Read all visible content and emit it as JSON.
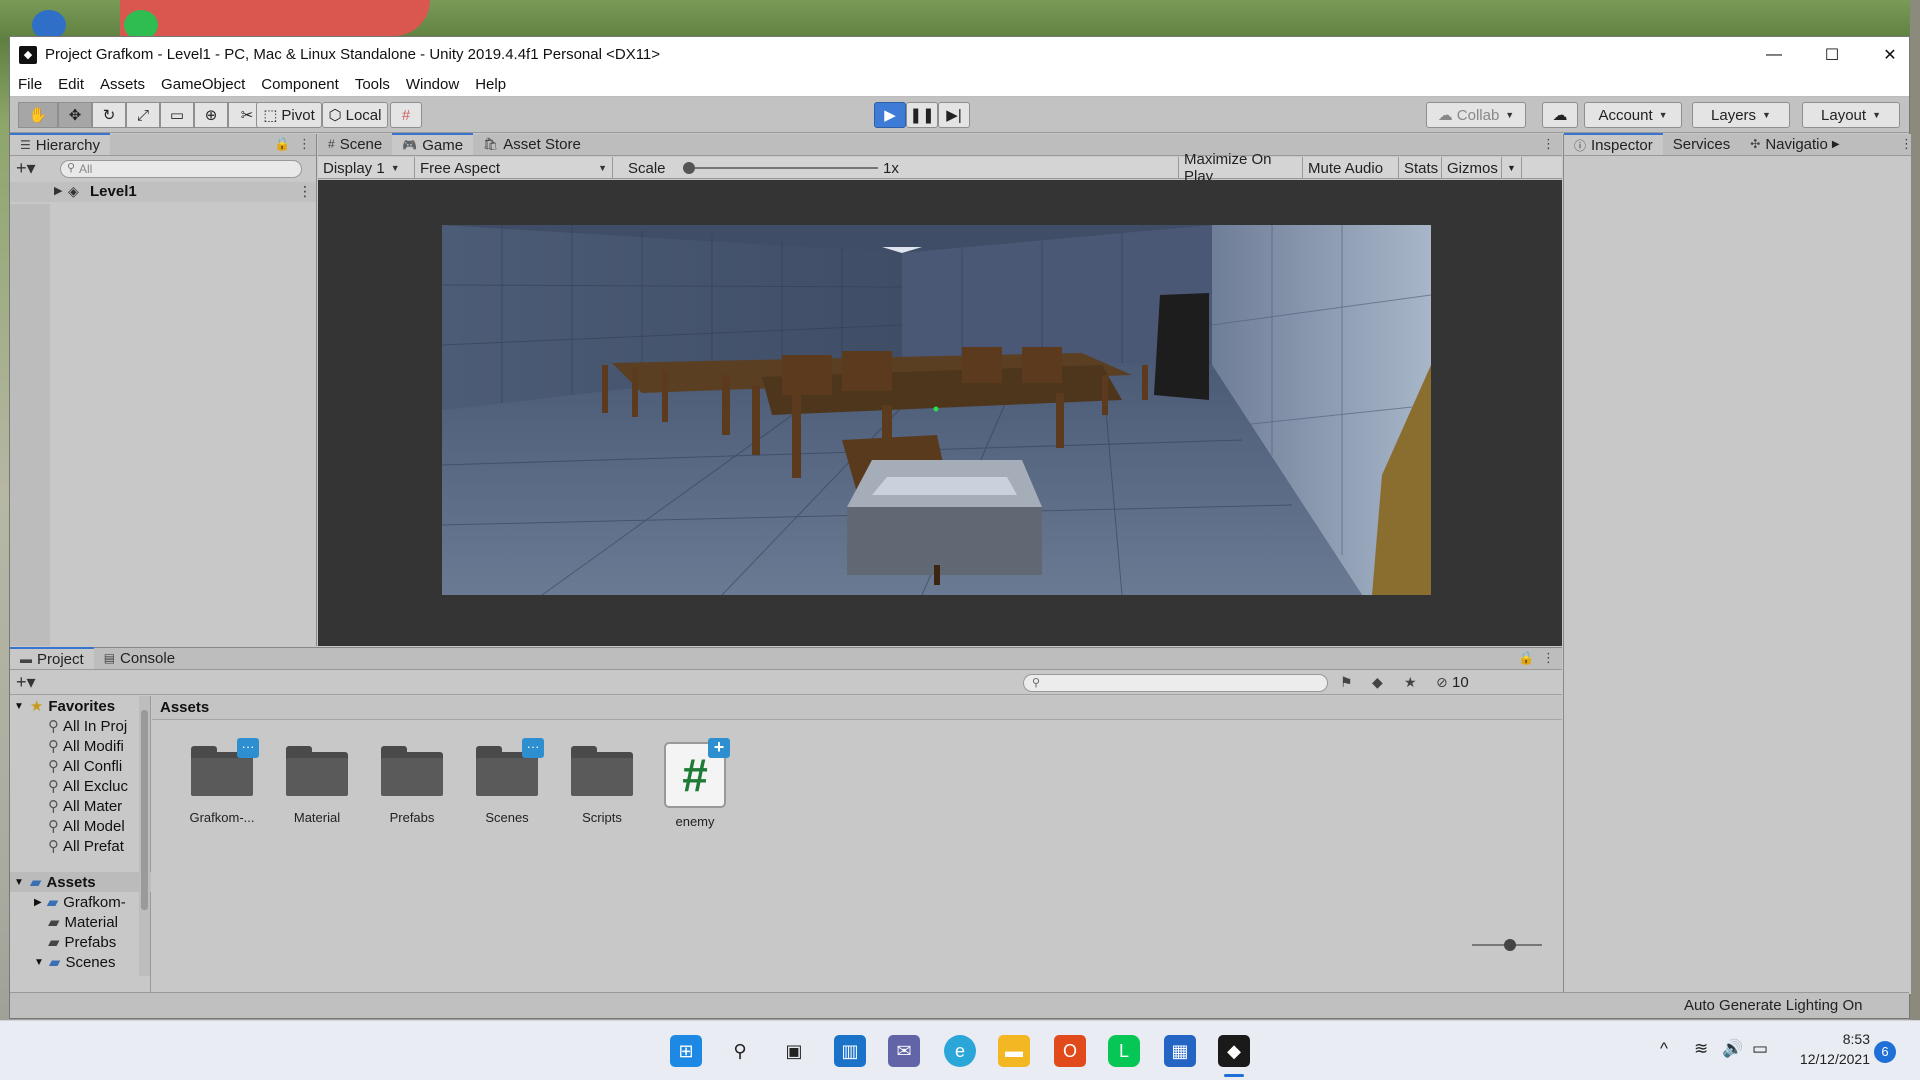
{
  "window": {
    "title": "Project Grafkom - Level1 - PC, Mac & Linux Standalone - Unity 2019.4.4f1 Personal <DX11>",
    "minimize": "—",
    "maximize": "☐",
    "close": "✕"
  },
  "menu": [
    "File",
    "Edit",
    "Assets",
    "GameObject",
    "Component",
    "Tools",
    "Window",
    "Help"
  ],
  "toolbar": {
    "pivot": "Pivot",
    "local": "Local",
    "collab": "Collab",
    "account": "Account",
    "layers": "Layers",
    "layout": "Layout"
  },
  "hierarchy": {
    "tab": "Hierarchy",
    "search_placeholder": "All",
    "scene_item": "Level1"
  },
  "center_tabs": {
    "scene": "Scene",
    "game": "Game",
    "asset_store": "Asset Store"
  },
  "game_toolbar": {
    "display": "Display 1",
    "aspect": "Free Aspect",
    "scale_label": "Scale",
    "scale_value": "1x",
    "maximize_on_play": "Maximize On Play",
    "mute_audio": "Mute Audio",
    "stats": "Stats",
    "gizmos": "Gizmos"
  },
  "right_tabs": {
    "inspector": "Inspector",
    "services": "Services",
    "navigation": "Navigatio"
  },
  "project": {
    "tab_project": "Project",
    "tab_console": "Console",
    "hidden_count": "10",
    "favorites_label": "Favorites",
    "favorites": [
      "All In Proj",
      "All Modifi",
      "All Confli",
      "All Excluc",
      "All Mater",
      "All Model",
      "All Prefat"
    ],
    "assets_label": "Assets",
    "asset_tree": [
      "Grafkom-",
      "Material",
      "Prefabs",
      "Scenes"
    ],
    "breadcrumb": "Assets",
    "items": [
      {
        "name": "Grafkom-...",
        "kind": "folder",
        "badge": "···"
      },
      {
        "name": "Material",
        "kind": "folder",
        "badge": ""
      },
      {
        "name": "Prefabs",
        "kind": "folder",
        "badge": ""
      },
      {
        "name": "Scenes",
        "kind": "folder",
        "badge": "···"
      },
      {
        "name": "Scripts",
        "kind": "folder",
        "badge": ""
      },
      {
        "name": "enemy",
        "kind": "script",
        "badge": "+"
      }
    ]
  },
  "status": {
    "auto_lighting": "Auto Generate Lighting On"
  },
  "taskbar": {
    "time": "8:53",
    "date": "12/12/2021",
    "notifications": "6"
  },
  "colors": {
    "accent": "#3d7bd6",
    "script_hash": "#1f7a36",
    "badge": "#2d8fcf",
    "game_bg": "#343434"
  }
}
